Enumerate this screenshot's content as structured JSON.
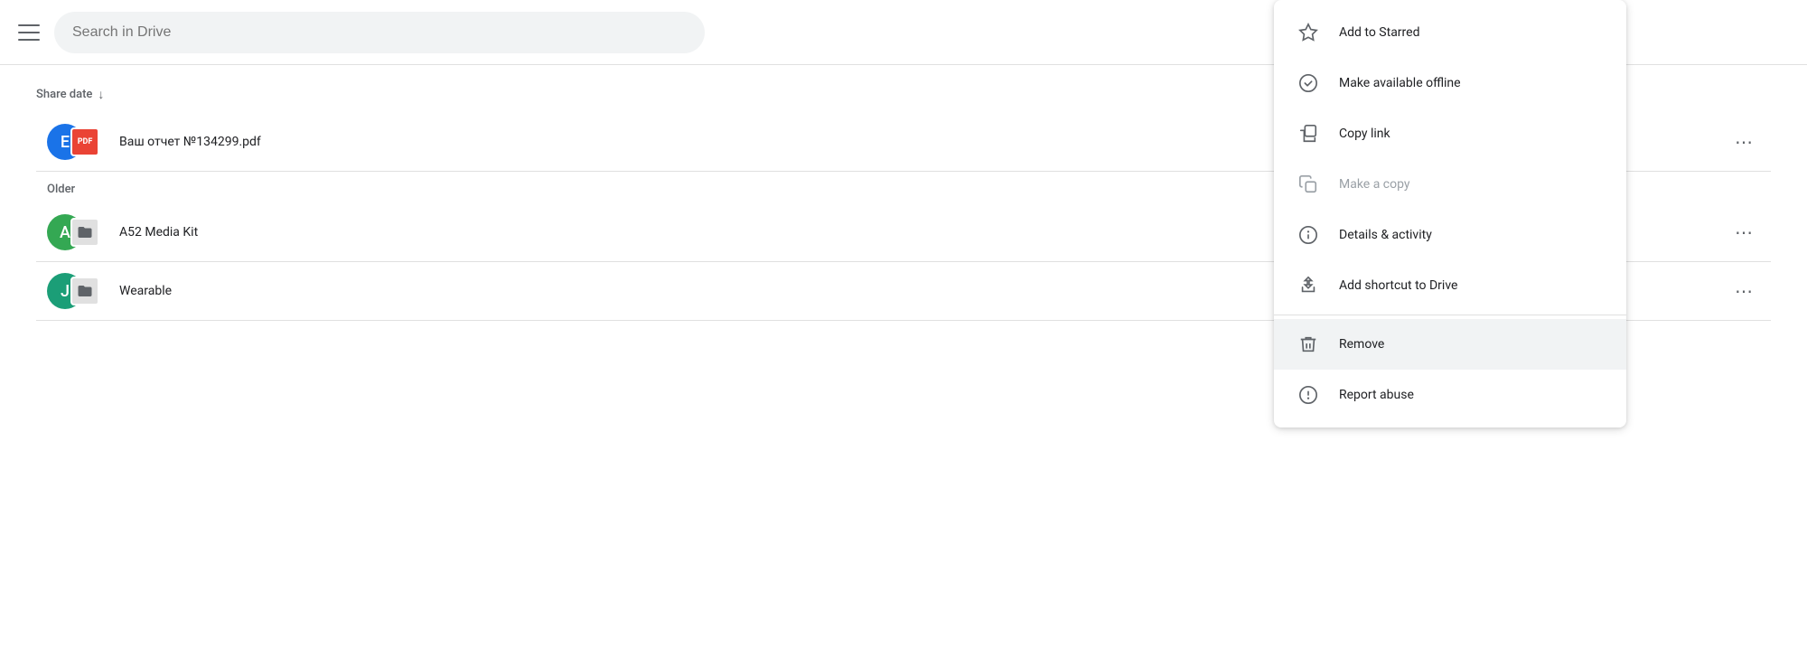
{
  "header": {
    "search_placeholder": "Search in Drive"
  },
  "sections": [
    {
      "label": "Share date",
      "has_sort": true,
      "files": [
        {
          "id": "file-1",
          "name": "Ваш отчет №134299.pdf",
          "avatar_letter": "E",
          "avatar_color": "#1a73e8",
          "badge_type": "pdf",
          "badge_label": "PDF"
        }
      ]
    },
    {
      "label": "Older",
      "has_sort": false,
      "files": [
        {
          "id": "file-2",
          "name": "A52 Media Kit",
          "avatar_letter": "A",
          "avatar_color": "#34a853",
          "badge_type": "folder",
          "badge_label": "📁"
        },
        {
          "id": "file-3",
          "name": "Wearable",
          "avatar_letter": "J",
          "avatar_color": "#1b9e77",
          "badge_type": "folder",
          "badge_label": "📁"
        }
      ]
    }
  ],
  "context_menu": {
    "items": [
      {
        "id": "add-starred",
        "label": "Add to Starred",
        "icon": "star",
        "disabled": false,
        "highlighted": false
      },
      {
        "id": "make-offline",
        "label": "Make available offline",
        "icon": "offline",
        "disabled": false,
        "highlighted": false
      },
      {
        "id": "copy-link",
        "label": "Copy link",
        "icon": "copy-link",
        "disabled": false,
        "highlighted": false
      },
      {
        "id": "make-copy",
        "label": "Make a copy",
        "icon": "copy",
        "disabled": true,
        "highlighted": false
      },
      {
        "id": "details",
        "label": "Details & activity",
        "icon": "info",
        "disabled": false,
        "highlighted": false
      },
      {
        "id": "add-shortcut",
        "label": "Add shortcut to Drive",
        "icon": "shortcut",
        "disabled": false,
        "highlighted": false
      },
      {
        "id": "remove",
        "label": "Remove",
        "icon": "trash",
        "disabled": false,
        "highlighted": true
      },
      {
        "id": "report-abuse",
        "label": "Report abuse",
        "icon": "warning",
        "disabled": false,
        "highlighted": false
      }
    ]
  },
  "icons": {
    "star": "☆",
    "offline": "⊙",
    "copy-link": "⧉",
    "copy": "❑",
    "info": "ⓘ",
    "shortcut": "⊕",
    "trash": "🗑",
    "warning": "⚠"
  }
}
